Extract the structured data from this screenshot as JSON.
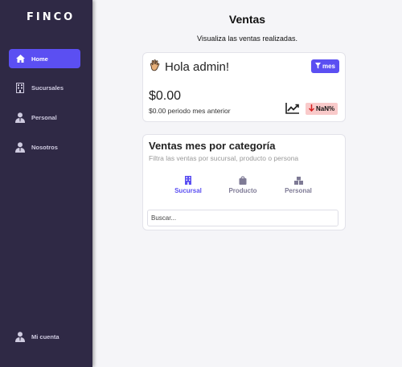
{
  "app": {
    "logo": "FINCO"
  },
  "sidebar": {
    "items": [
      {
        "label": "Home",
        "icon": "home-icon",
        "active": true
      },
      {
        "label": "Sucursales",
        "icon": "building-icon"
      },
      {
        "label": "Personal",
        "icon": "user-tie-icon"
      },
      {
        "label": "Nosotros",
        "icon": "user-tie-icon"
      }
    ],
    "account": {
      "label": "Mi cuenta",
      "icon": "user-tie-icon"
    }
  },
  "page": {
    "title": "Ventas",
    "subtitle": "Visualiza las ventas realizadas."
  },
  "summary": {
    "greeting": "Hola admin!",
    "greeting_icon": "waving-hand-icon",
    "filter_label": "mes",
    "amount": "$0.00",
    "previous": "$0.00 periodo mes anterior",
    "change": "NaN%",
    "change_direction": "down"
  },
  "categories": {
    "title": "Ventas mes por categoría",
    "subtitle": "Filtra las ventas por sucursal, producto o persona",
    "tabs": [
      {
        "label": "Sucursal",
        "icon": "building-icon",
        "active": true
      },
      {
        "label": "Producto",
        "icon": "bag-icon"
      },
      {
        "label": "Personal",
        "icon": "boxes-icon"
      }
    ],
    "search_placeholder": "Buscar..."
  },
  "colors": {
    "sidebar": "#2f2945",
    "accent": "#5b4ff2",
    "badge_bg": "#f9caca",
    "badge_text": "#d62020"
  }
}
